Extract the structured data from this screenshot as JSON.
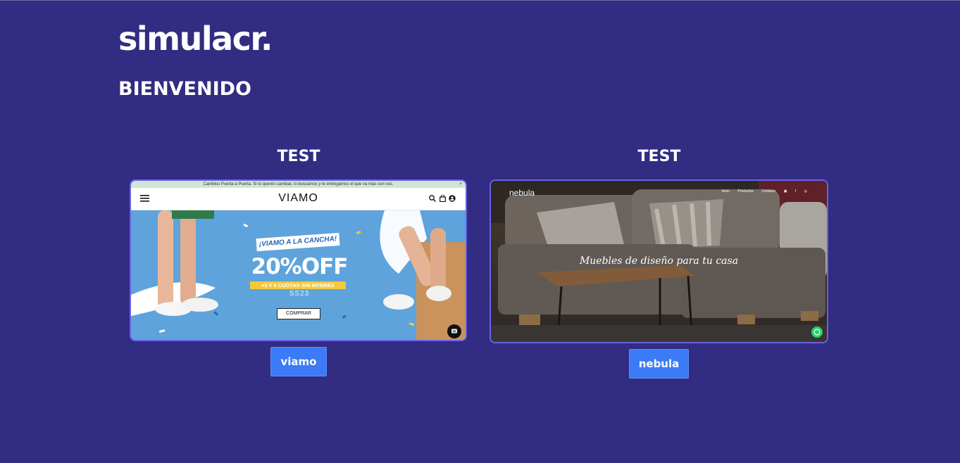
{
  "header": {
    "logo": "simulacr.",
    "welcome": "BIENVENIDO"
  },
  "cards": [
    {
      "title": "TEST",
      "button_label": "viamo",
      "preview": {
        "announcement": "Cambios Puerta a Puerta. Si lo querés cambiar, lo buscamos y te entregamos el que va más con vos.",
        "brand": "VIAMO",
        "promo_tag": "¡VIAMO A LA CANCHA!",
        "promo_discount": "20%OFF",
        "promo_installments": "+3 Y 6 CUOTAS SIN INTERÉS",
        "season": "SS23",
        "cta": "COMPRAR"
      }
    },
    {
      "title": "TEST",
      "button_label": "nebula",
      "preview": {
        "brand": "nebula",
        "nav_links": [
          "Inicio",
          "Productos",
          "Contacto"
        ],
        "tagline": "Muebles de diseño para tu casa"
      }
    }
  ],
  "colors": {
    "background": "#322c82",
    "button": "#3b7cf6",
    "card_border": "#6a61e8"
  }
}
